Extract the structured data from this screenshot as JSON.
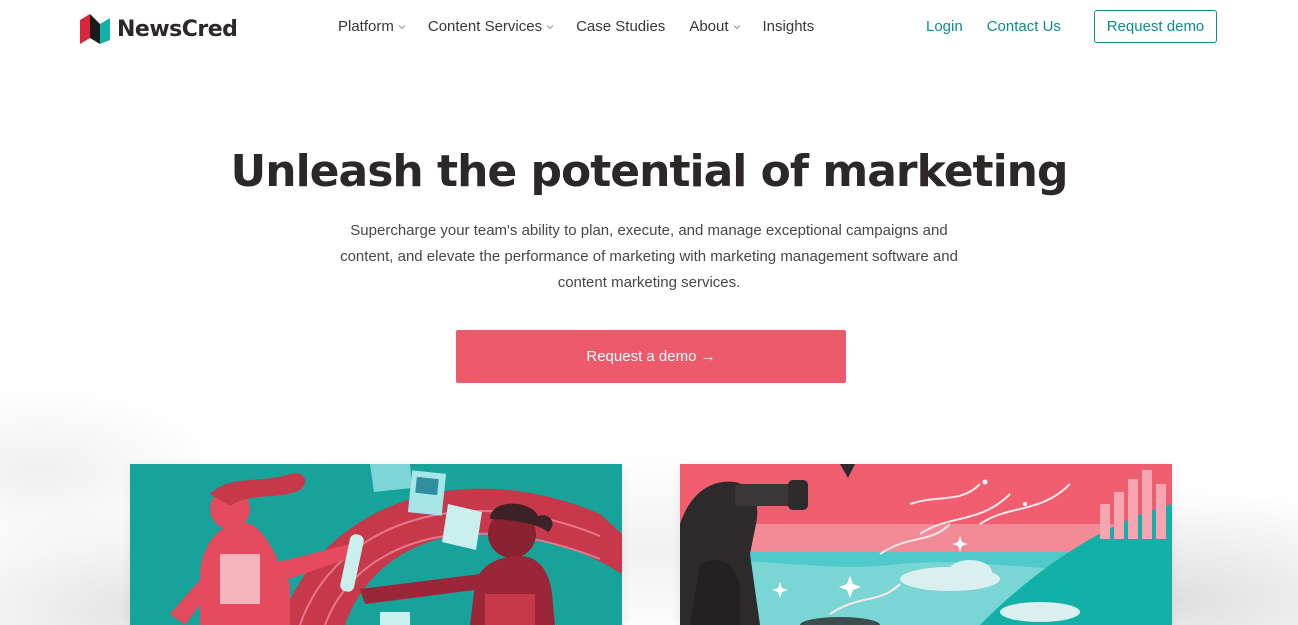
{
  "brand": {
    "name": "NewsCred",
    "colors": {
      "teal": "#0b8f8c",
      "coral": "#ec5a6c",
      "dark": "#2b2827"
    }
  },
  "nav": {
    "items": [
      {
        "label": "Platform",
        "dropdown": true
      },
      {
        "label": "Content Services",
        "dropdown": true
      },
      {
        "label": "Case Studies",
        "dropdown": false
      },
      {
        "label": "About",
        "dropdown": true
      },
      {
        "label": "Insights",
        "dropdown": false
      }
    ],
    "login": "Login",
    "contact": "Contact Us",
    "request_demo": "Request demo"
  },
  "hero": {
    "title": "Unleash the potential of marketing",
    "subtitle": "Supercharge your team's ability to plan, execute, and manage exceptional campaigns and content, and elevate the performance of marketing with marketing management software and content marketing services.",
    "cta": "Request a demo →"
  }
}
